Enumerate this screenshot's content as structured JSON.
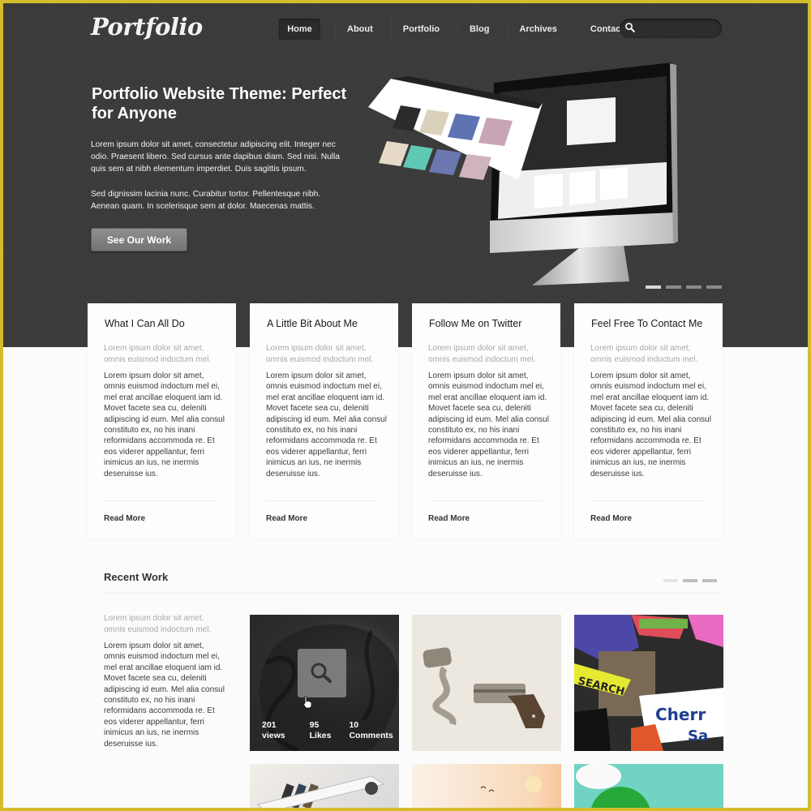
{
  "site": {
    "logo": "Portfolio"
  },
  "nav": {
    "items": [
      {
        "label": "Home",
        "active": true
      },
      {
        "label": "About"
      },
      {
        "label": "Portfolio"
      },
      {
        "label": "Blog"
      },
      {
        "label": "Archives"
      },
      {
        "label": "Contact"
      }
    ],
    "search": {
      "placeholder": "",
      "value": "",
      "icon": "search-icon"
    }
  },
  "hero": {
    "title": "Portfolio Website Theme: Perfect for Anyone",
    "paragraph1": "Lorem ipsum dolor sit amet, consectetur adipiscing elit. Integer nec odio. Praesent libero. Sed cursus ante dapibus diam. Sed nisi. Nulla quis sem at nibh elementum imperdiet. Duis sagittis ipsum.",
    "paragraph2": "Sed dignissim lacinia nunc. Curabitur tortor. Pellentesque nibh. Aenean quam. In scelerisque sem at dolor. Maecenas mattis.",
    "cta_label": "See Our Work",
    "slider": {
      "count": 4,
      "active_index": 0
    },
    "illustration": "imac-with-floating-website-screen"
  },
  "cards": [
    {
      "title": "What I Can All Do",
      "subtitle": "Lorem ipsum dolor sit amet, omnis euismod indoctum mel.",
      "body": "Lorem ipsum dolor sit amet, omnis euismod indoctum mel ei, mel erat ancillae eloquent iam id. Movet facete sea cu, deleniti adipiscing id eum. Mel alia consul constituto ex, no his inani reformidans accommoda re. Et eos viderer appellantur, ferri inimicus an ius, ne inermis deseruisse ius.",
      "link": "Read More"
    },
    {
      "title": "A Little Bit About Me",
      "subtitle": "Lorem ipsum dolor sit amet, omnis euismod indoctum mel.",
      "body": "Lorem ipsum dolor sit amet, omnis euismod indoctum mel ei, mel erat ancillae eloquent iam id. Movet facete sea cu, deleniti adipiscing id eum. Mel alia consul constituto ex, no his inani reformidans accommoda re. Et eos viderer appellantur, ferri inimicus an ius, ne inermis deseruisse ius.",
      "link": "Read More"
    },
    {
      "title": "Follow Me on Twitter",
      "subtitle": "Lorem ipsum dolor sit amet, omnis euismod indoctum mel.",
      "body": "Lorem ipsum dolor sit amet, omnis euismod indoctum mel ei, mel erat ancillae eloquent iam id. Movet facete sea cu, deleniti adipiscing id eum. Mel alia consul constituto ex, no his inani reformidans accommoda re. Et eos viderer appellantur, ferri inimicus an ius, ne inermis deseruisse ius.",
      "link": "Read More"
    },
    {
      "title": "Feel Free To Contact Me",
      "subtitle": "Lorem ipsum dolor sit amet, omnis euismod indoctum mel.",
      "body": "Lorem ipsum dolor sit amet, omnis euismod indoctum mel ei, mel erat ancillae eloquent iam id. Movet facete sea cu, deleniti adipiscing id eum. Mel alia consul constituto ex, no his inani reformidans accommoda re. Et eos viderer appellantur, ferri inimicus an ius, ne inermis deseruisse ius.",
      "link": "Read More"
    }
  ],
  "recent_work": {
    "title": "Recent Work",
    "subtitle": "Lorem ipsum dolor sit amet, omnis euismod indoctum mel.",
    "body": "Lorem ipsum dolor sit amet, omnis euismod indoctum mel ei, mel erat ancillae eloquent iam id. Movet facete sea cu, deleniti adipiscing id eum. Mel alia consul constituto ex, no his inani reformidans accommoda re. Et eos viderer appellantur, ferri inimicus an ius, ne inermis deseruisse ius.",
    "pager": {
      "count": 3,
      "active_index": 0
    },
    "items": [
      {
        "image": "woman-hair-bw-photo",
        "hovered": true,
        "stats": [
          {
            "value": "201",
            "label": "views"
          },
          {
            "value": "95",
            "label": "Likes"
          },
          {
            "value": "10",
            "label": "Comments"
          }
        ]
      },
      {
        "image": "derringer-pistol-illustration"
      },
      {
        "image": "sticker-collage"
      },
      {
        "image": "airplanes-illustration"
      },
      {
        "image": "sunset-birds-illustration"
      },
      {
        "image": "green-character-teal-bg"
      }
    ]
  },
  "colors": {
    "frame": "#d4bc2c",
    "hero_bg": "#3a3a3a",
    "page_bg": "#fbfbfb",
    "cta_bg": "#848484"
  }
}
